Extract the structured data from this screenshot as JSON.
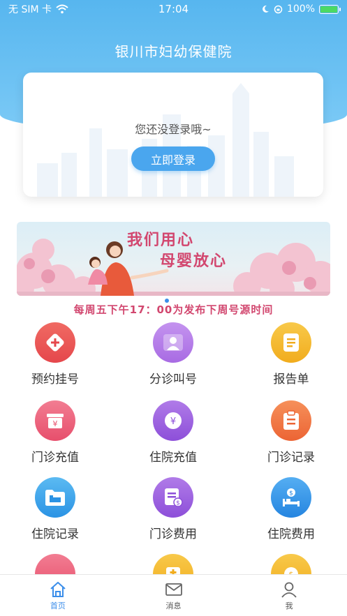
{
  "status_bar": {
    "carrier": "无 SIM 卡",
    "time": "17:04",
    "battery": "100%"
  },
  "app_title": "银川市妇幼保健院",
  "login_card": {
    "hint": "您还没登录哦~",
    "button_label": "立即登录"
  },
  "banner": {
    "line1": "我们用心",
    "line2": "母婴放心"
  },
  "notice": "每周五下午17：00为发布下周号源时间",
  "grid": [
    {
      "label": "预约挂号",
      "icon": "hospital-cross-icon",
      "color": "#ea4f53"
    },
    {
      "label": "分诊叫号",
      "icon": "person-icon",
      "color": "#b47ae8"
    },
    {
      "label": "报告单",
      "icon": "document-icon",
      "color": "#f4b72c"
    },
    {
      "label": "门诊充值",
      "icon": "wallet-yuan-icon",
      "color": "#ec5f79"
    },
    {
      "label": "住院充值",
      "icon": "yuan-coin-icon",
      "color": "#9a5ee0"
    },
    {
      "label": "门诊记录",
      "icon": "clipboard-icon",
      "color": "#f07440"
    },
    {
      "label": "住院记录",
      "icon": "folder-bed-icon",
      "color": "#3aa6ec"
    },
    {
      "label": "门诊费用",
      "icon": "receipt-dollar-icon",
      "color": "#9a5ee0"
    },
    {
      "label": "住院费用",
      "icon": "bed-dollar-icon",
      "color": "#3a9ae8"
    }
  ],
  "tabbar": {
    "tabs": [
      {
        "label": "首页",
        "icon": "home-icon",
        "active": true
      },
      {
        "label": "消息",
        "icon": "mail-icon",
        "active": false
      },
      {
        "label": "我",
        "icon": "user-icon",
        "active": false
      }
    ]
  },
  "colors": {
    "primary": "#3b8eea",
    "hero": "#57b6ef",
    "accent_pink": "#d2476f"
  }
}
